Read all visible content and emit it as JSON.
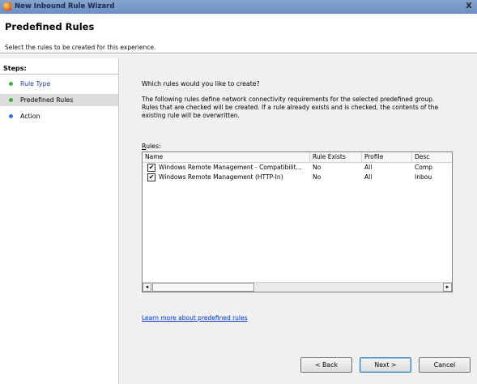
{
  "window": {
    "title": "New Inbound Rule Wizard",
    "close_glyph": "X"
  },
  "header": {
    "title": "Predefined Rules",
    "subtitle": "Select the rules to be created for this experience."
  },
  "steps": {
    "title": "Steps:",
    "items": [
      {
        "label": "Rule Type",
        "dot_color": "#3cae3c"
      },
      {
        "label": "Predefined Rules",
        "dot_color": "#3cae3c"
      },
      {
        "label": "Action",
        "dot_color": "#3b6fd6"
      }
    ]
  },
  "main": {
    "question": "Which rules would you like to create?",
    "description": "The following rules define network connectivity requirements for the selected predefined group. Rules that are checked will be created. If a rule already exists and is checked, the contents of the existing rule will be overwritten.",
    "rules_label_first": "R",
    "rules_label_rest": "ules:",
    "columns": [
      "Name",
      "Rule Exists",
      "Profile",
      "Desc"
    ],
    "rows": [
      {
        "checked": true,
        "name": "Windows Remote Management - Compatibilit...",
        "exists": "No",
        "profile": "All",
        "desc": "Comp"
      },
      {
        "checked": true,
        "name": "Windows Remote Management (HTTP-In)",
        "exists": "No",
        "profile": "All",
        "desc": "Inbou"
      }
    ],
    "learn_more": "Learn more about predefined rules"
  },
  "buttons": {
    "back": "< Back",
    "next": "Next >",
    "cancel": "Cancel"
  },
  "glyphs": {
    "check": "✔",
    "scroll_left": "◂",
    "scroll_right": "▸"
  }
}
